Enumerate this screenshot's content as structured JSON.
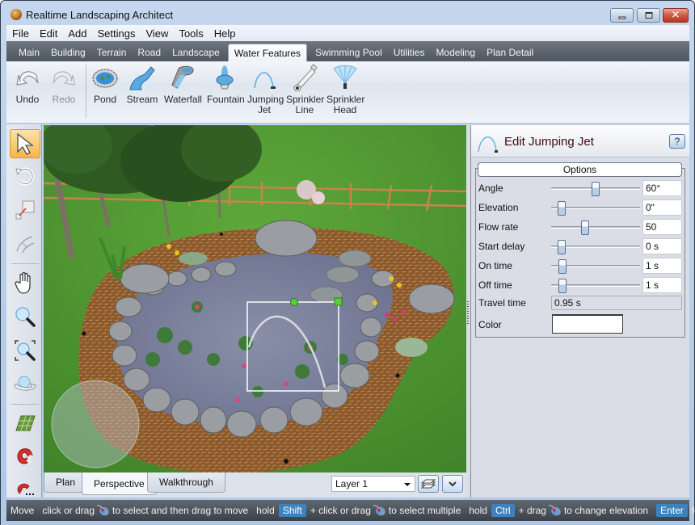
{
  "window": {
    "title": "Realtime Landscaping Architect",
    "controls": [
      "minimize",
      "maximize",
      "close"
    ]
  },
  "menu": [
    "File",
    "Edit",
    "Add",
    "Settings",
    "View",
    "Tools",
    "Help"
  ],
  "tabs": [
    {
      "label": "Main",
      "active": false
    },
    {
      "label": "Building",
      "active": false
    },
    {
      "label": "Terrain",
      "active": false
    },
    {
      "label": "Road",
      "active": false
    },
    {
      "label": "Landscape",
      "active": false
    },
    {
      "label": "Water Features",
      "active": true
    },
    {
      "label": "Swimming Pool",
      "active": false
    },
    {
      "label": "Utilities",
      "active": false
    },
    {
      "label": "Modeling",
      "active": false
    },
    {
      "label": "Plan Detail",
      "active": false
    }
  ],
  "ribbon": {
    "undo": {
      "label": "Undo",
      "icon": "undo-arrow-icon"
    },
    "redo": {
      "label": "Redo",
      "icon": "redo-arrow-icon",
      "disabled": true
    },
    "items": [
      {
        "line1": "Pond",
        "line2": "",
        "icon": "pond-icon"
      },
      {
        "line1": "Stream",
        "line2": "",
        "icon": "stream-icon"
      },
      {
        "line1": "Waterfall",
        "line2": "",
        "icon": "waterfall-icon"
      },
      {
        "line1": "Fountain",
        "line2": "",
        "icon": "fountain-icon"
      },
      {
        "line1": "Jumping",
        "line2": "Jet",
        "icon": "jumping-jet-icon"
      },
      {
        "line1": "Sprinkler",
        "line2": "Line",
        "icon": "sprinkler-line-icon"
      },
      {
        "line1": "Sprinkler",
        "line2": "Head",
        "icon": "sprinkler-head-icon"
      }
    ]
  },
  "left_tools": [
    {
      "name": "select-arrow",
      "active": true
    },
    {
      "name": "rotate"
    },
    {
      "name": "resize"
    },
    {
      "name": "curve"
    },
    {
      "name": "pan-hand"
    },
    {
      "name": "zoom"
    },
    {
      "name": "zoom-extents"
    },
    {
      "name": "orbit"
    },
    {
      "name": "grid"
    },
    {
      "name": "snap-magnet"
    },
    {
      "name": "snap-magnet-options"
    }
  ],
  "viewport": {
    "view_tabs": [
      {
        "label": "Plan",
        "active": false
      },
      {
        "label": "Perspective",
        "active": true
      },
      {
        "label": "Walkthrough",
        "active": false
      }
    ],
    "layer": "Layer 1"
  },
  "panel": {
    "title": "Edit Jumping Jet",
    "help": "?",
    "group_label": "Options",
    "properties": [
      {
        "label": "Angle",
        "value": "60°",
        "slider": 0.5
      },
      {
        "label": "Elevation",
        "value": "0\"",
        "slider": 0.12
      },
      {
        "label": "Flow rate",
        "value": "50",
        "slider": 0.38
      },
      {
        "label": "Start delay",
        "value": "0 s",
        "slider": 0.12
      },
      {
        "label": "On time",
        "value": "1 s",
        "slider": 0.13
      },
      {
        "label": "Off time",
        "value": "1 s",
        "slider": 0.13
      }
    ],
    "travel_time": {
      "label": "Travel time",
      "value": "0.95 s"
    },
    "color": {
      "label": "Color",
      "value": "#ffffff"
    }
  },
  "status": {
    "mode": "Move",
    "hint1_pre": "click or drag",
    "hint1_post": "to select and then drag to move",
    "hold1": "hold",
    "key1": "Shift",
    "hint2_pre": "+ click or drag",
    "hint2_post": "to select multiple",
    "hold2": "hold",
    "key2": "Ctrl",
    "hint3_pre": "+ drag",
    "hint3_post": "to change elevation",
    "key3": "Enter",
    "hint4": "for keyboard"
  },
  "colors": {
    "accent_key": "#3d82bf",
    "active_tool": "#f7b54a",
    "selection_handle": "#6fd23f"
  }
}
